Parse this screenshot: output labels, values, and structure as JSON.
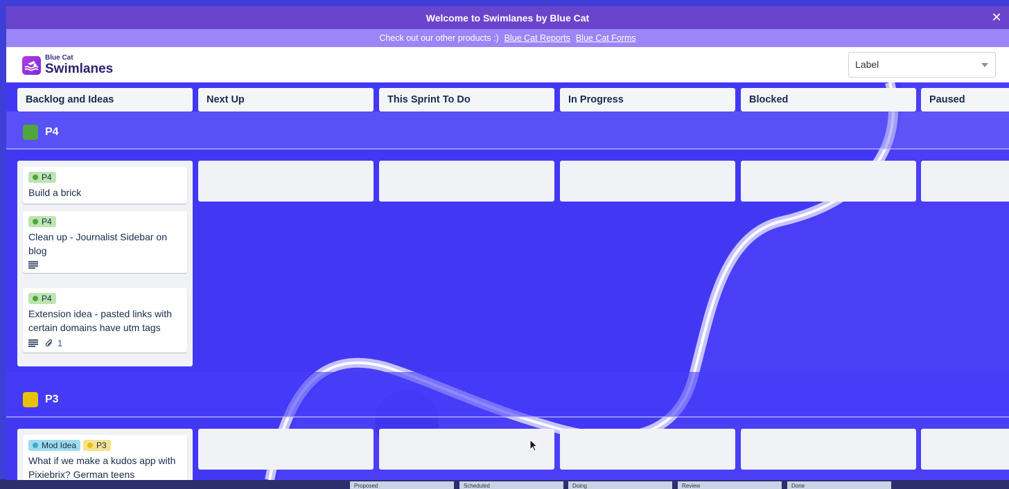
{
  "window": {
    "title": "Welcome to Swimlanes by Blue Cat",
    "close_icon": "close-icon"
  },
  "promo": {
    "text": "Check out our other products :)",
    "links": [
      "Blue Cat Reports",
      "Blue Cat Forms"
    ]
  },
  "brand": {
    "small": "Blue Cat",
    "big": "Swimlanes",
    "logo_icon": "swimmer-icon"
  },
  "group_select": {
    "value": "Label"
  },
  "columns": [
    "Backlog and Ideas",
    "Next Up",
    "This Sprint To Do",
    "In Progress",
    "Blocked",
    "Paused"
  ],
  "lanes": [
    {
      "name": "P4",
      "color": "#4ea63c",
      "cards": [
        {
          "labels": [
            {
              "text": "P4",
              "bg": "#bde5b0",
              "dot": "#4ea63c"
            }
          ],
          "title": "Build a brick"
        },
        {
          "labels": [
            {
              "text": "P4",
              "bg": "#bde5b0",
              "dot": "#4ea63c"
            }
          ],
          "title": "Clean up - Journalist Sidebar on blog",
          "has_description": true
        },
        {
          "labels": [
            {
              "text": "P4",
              "bg": "#bde5b0",
              "dot": "#4ea63c"
            }
          ],
          "title": "Extension idea - pasted links with certain domains have utm tags",
          "has_description": true,
          "attachments": "1"
        }
      ]
    },
    {
      "name": "P3",
      "color": "#e8c20a",
      "cards": [
        {
          "labels": [
            {
              "text": "Mod Idea",
              "bg": "#9edcec",
              "dot": "#3fa9cc"
            },
            {
              "text": "P3",
              "bg": "#f3e38e",
              "dot": "#e8c20a"
            }
          ],
          "title": "What if we make a kudos app with Pixiebrix? German teens"
        }
      ]
    }
  ],
  "underlying_tabs": [
    "Proposed",
    "Scheduled",
    "Doing",
    "Review",
    "Done"
  ]
}
